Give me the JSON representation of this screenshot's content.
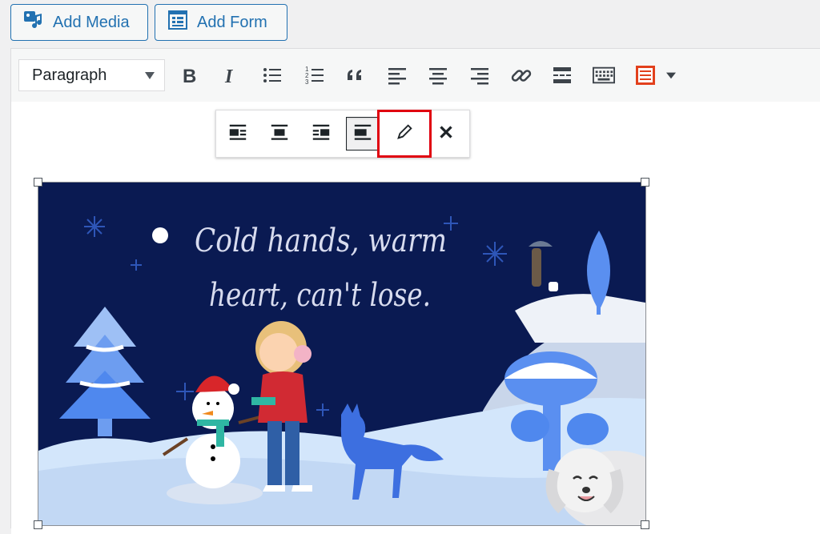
{
  "top_buttons": {
    "add_media_label": "Add Media",
    "add_form_label": "Add Form"
  },
  "toolbar": {
    "format_value": "Paragraph",
    "icons": [
      "bold-icon",
      "italic-icon",
      "bulleted-list-icon",
      "numbered-list-icon",
      "blockquote-icon",
      "align-left-icon",
      "align-center-icon",
      "align-right-icon",
      "link-icon",
      "read-more-icon",
      "toolbar-toggle-icon",
      "form-icon",
      "dropdown-caret-icon"
    ]
  },
  "image": {
    "quote_line1": "Cold hands, warm",
    "quote_line2": "heart, can't lose."
  },
  "image_toolbar": {
    "icons": [
      "align-left-icon",
      "align-center-icon",
      "align-right-icon",
      "align-none-icon",
      "edit-pencil-icon",
      "remove-icon"
    ],
    "active": "align-none-icon",
    "highlighted": "edit-pencil-icon"
  },
  "colors": {
    "accent": "#2271b1",
    "highlight": "#e0000f",
    "night_sky": "#0a1a52",
    "snow": "#d3e6fb"
  }
}
